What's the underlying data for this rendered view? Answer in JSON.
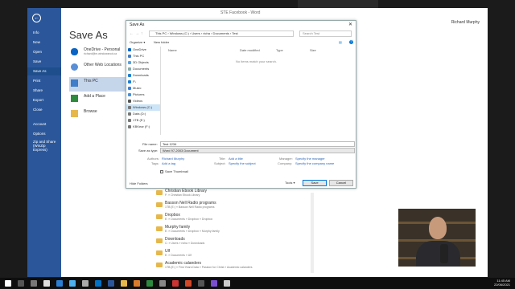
{
  "word": {
    "title": "STE Facebook - Word",
    "user": "Richard Murphy",
    "page_title": "Save As"
  },
  "backstage": {
    "items": [
      "Info",
      "New",
      "Open",
      "Save",
      "Save As",
      "Print",
      "Share",
      "Export",
      "Close",
      "Account",
      "Options",
      "Zip and Share (WinZip Express)"
    ],
    "active_index": 4
  },
  "locations": [
    {
      "title": "OneDrive - Personal",
      "sub": "richard@m.windowsnot.ca"
    },
    {
      "title": "Other Web Locations",
      "sub": ""
    },
    {
      "title": "This PC",
      "sub": ""
    },
    {
      "title": "Add a Place",
      "sub": ""
    },
    {
      "title": "Browse",
      "sub": ""
    }
  ],
  "folders": [
    {
      "name": "Christian Ebook Library",
      "path": "F: » Christian Ebook Library"
    },
    {
      "name": "Basson Nell Radio programs",
      "path": "1TB (E:) » Basson Nell Radio programs"
    },
    {
      "name": "Dropbox",
      "path": "E: » Documents » Dropbox » Dropbox"
    },
    {
      "name": "Murphy family",
      "path": "E: » Documents » Dropbox » Murphy family"
    },
    {
      "name": "Downloads",
      "path": "C: » Users » richa » Downloads"
    },
    {
      "name": "Ulf",
      "path": "E: » Documents » Ulf"
    },
    {
      "name": "Academic calanders",
      "path": "1TB (E:) » First Years Data » Passion for Christ » Academic calanders"
    }
  ],
  "dialog": {
    "title": "Save As",
    "address": "This PC  ›  Windows (C:)  ›  Users  ›  richa  ›  Documents  ›  Test",
    "search_placeholder": "Search Test",
    "organize": "Organize ▾",
    "new_folder": "New folder",
    "nav_items": [
      "OneDrive",
      "This PC",
      "3D Objects",
      "Documents",
      "Downloads",
      "F\\",
      "Music",
      "Pictures",
      "Videos",
      "Windows (C:)",
      "Data (D:)",
      "1TB (E:)",
      "KBKear (F:)"
    ],
    "nav_selected": 9,
    "columns": [
      "Name",
      "Date modified",
      "Type",
      "Size"
    ],
    "empty_message": "No items match your search.",
    "file_name_label": "File name:",
    "file_name_value": "Test 1234",
    "save_as_type_label": "Save as type:",
    "save_as_type_value": "Word 97-2003 Document",
    "authors_label": "Authors:",
    "authors_value": "Richard Murphy",
    "tags_label": "Tags:",
    "tags_value": "Add a tag",
    "title_label": "Title:",
    "title_value": "Add a title",
    "subject_label": "Subject:",
    "subject_value": "Specify the subject",
    "manager_label": "Manager:",
    "manager_value": "Specify the manager",
    "company_label": "Company:",
    "company_value": "Specify the company name",
    "thumbnail_label": "Save Thumbnail",
    "hide_folders": "Hide Folders",
    "tools": "Tools ▾",
    "save": "Save",
    "cancel": "Cancel"
  },
  "clock": {
    "time": "11:45 AM",
    "date": "22/06/2021"
  },
  "colors": {
    "word_blue": "#2b579a",
    "accent": "#0078d7"
  }
}
